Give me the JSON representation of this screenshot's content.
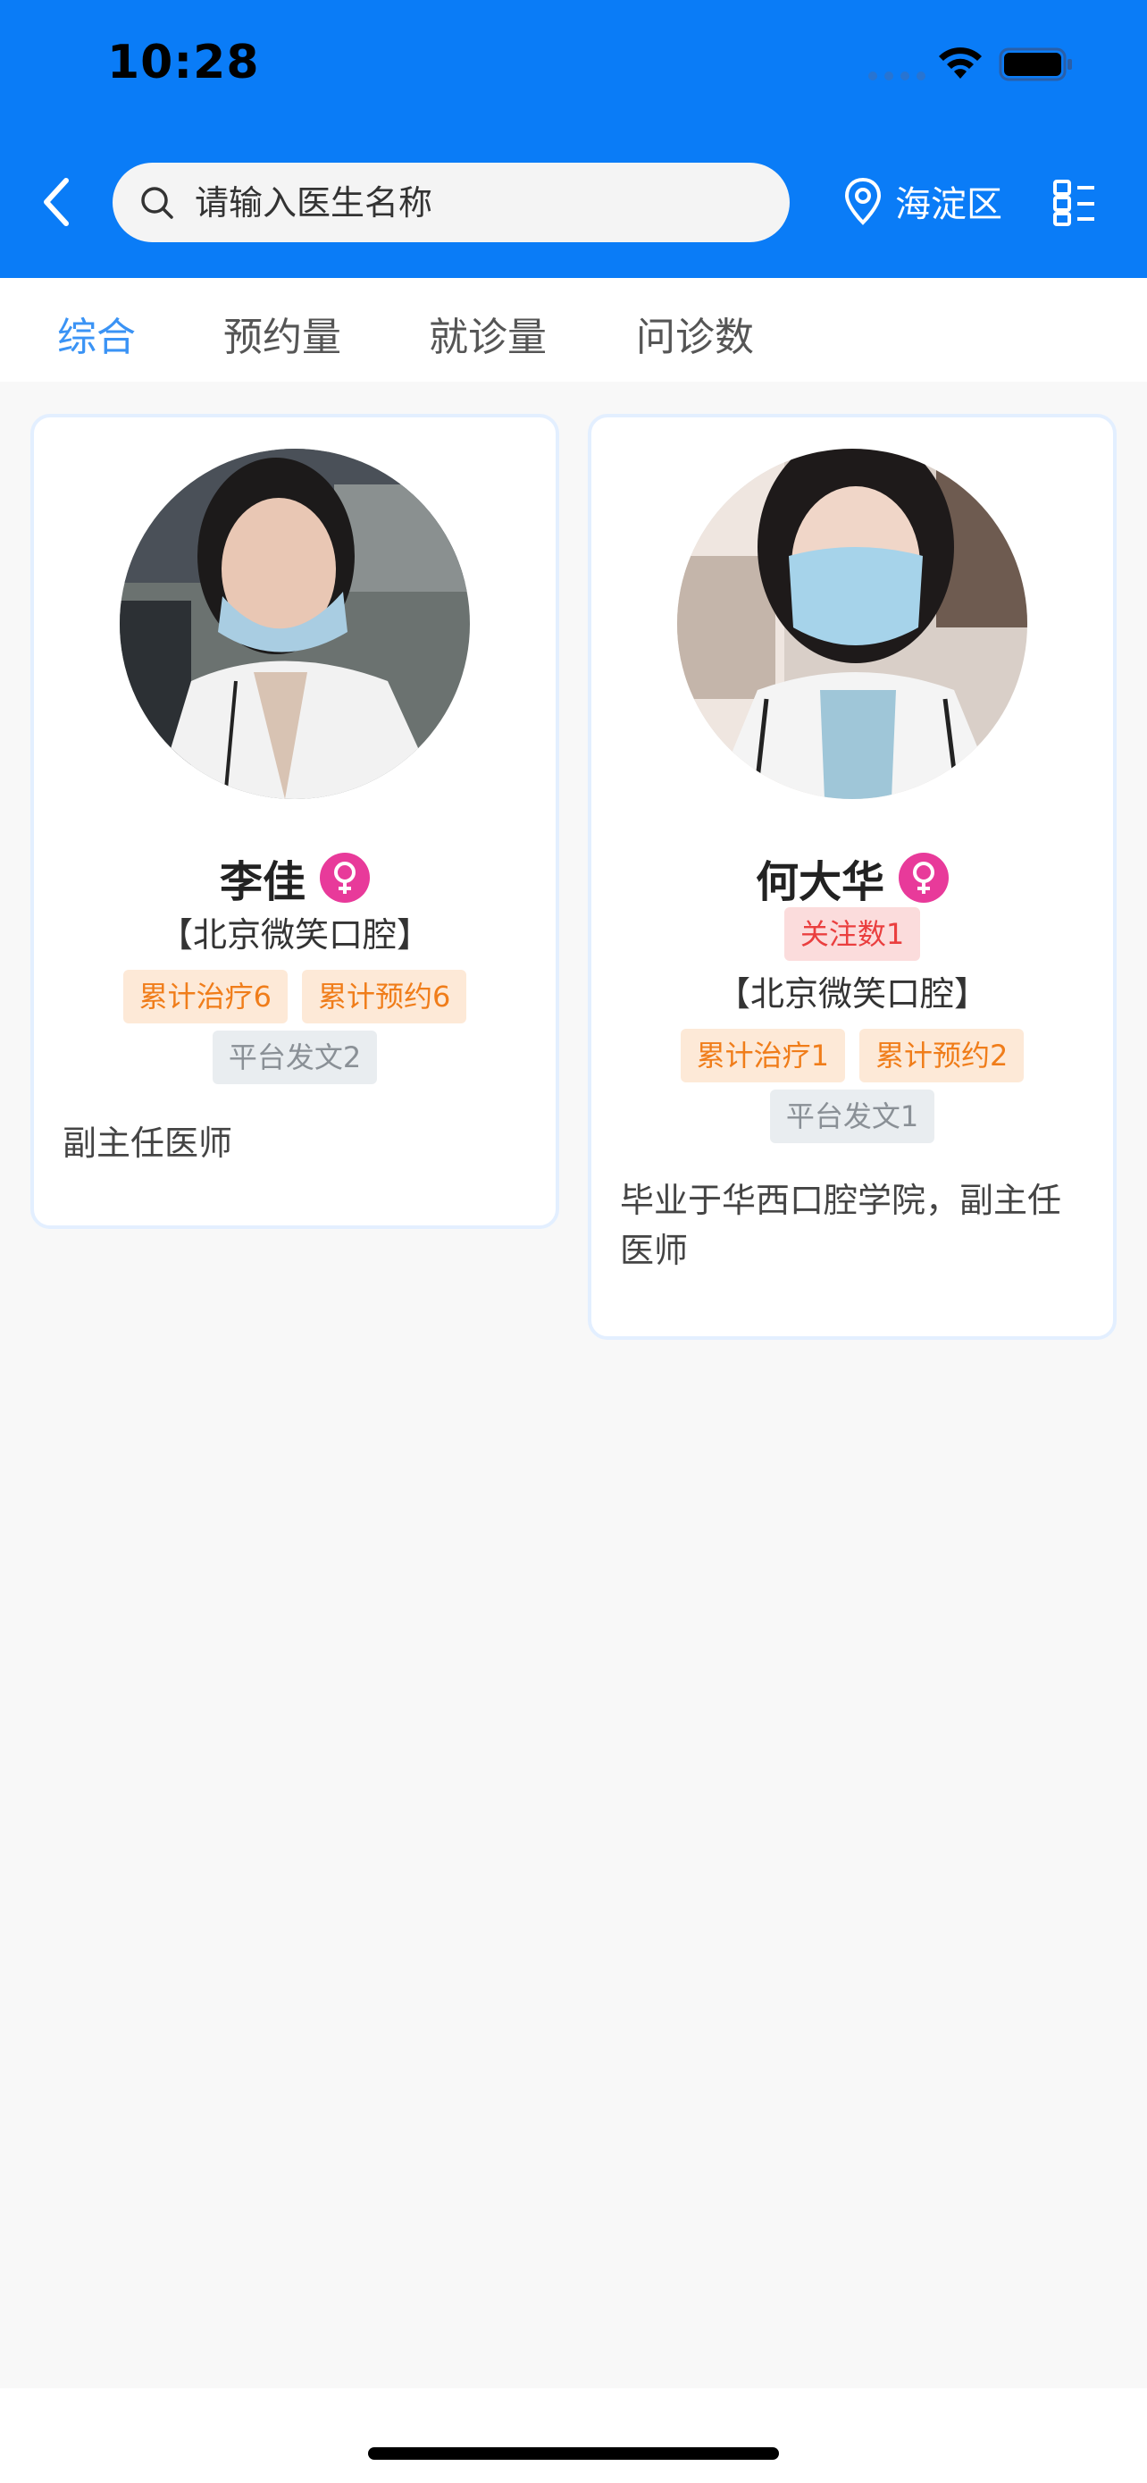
{
  "status_bar": {
    "time": "10:28"
  },
  "nav": {
    "search_placeholder": "请输入医生名称",
    "location": "海淀区"
  },
  "tabs": [
    {
      "label": "综合",
      "active": true
    },
    {
      "label": "预约量",
      "active": false
    },
    {
      "label": "就诊量",
      "active": false
    },
    {
      "label": "问诊数",
      "active": false
    }
  ],
  "doctors": [
    {
      "name": "李佳",
      "gender_icon": "female-icon",
      "hospital": "【北京微笑口腔】",
      "tags_orange": [
        "累计治疗6",
        "累计预约6"
      ],
      "tag_gray": "平台发文2",
      "description": "副主任医师"
    },
    {
      "name": "何大华",
      "gender_icon": "female-icon",
      "follow_tag": "关注数1",
      "hospital": "【北京微笑口腔】",
      "tags_orange": [
        "累计治疗1",
        "累计预约2"
      ],
      "tag_gray": "平台发文1",
      "description_line1": "毕业于华西口腔学院，副主任",
      "description_line2": "医师"
    }
  ],
  "colors": {
    "header": "#0a7cf7",
    "tab_active": "#3a93f5",
    "female": "#e83a9a"
  }
}
